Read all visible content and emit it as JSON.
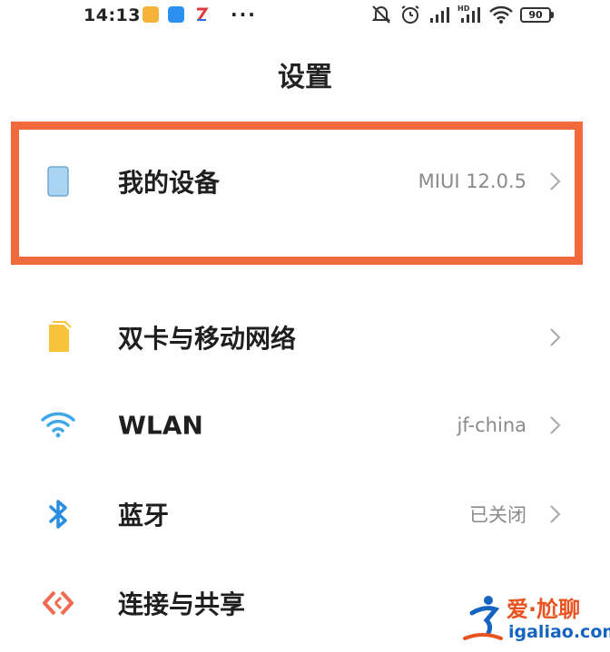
{
  "status_bar": {
    "time": "14:13",
    "more": "···",
    "battery": "90"
  },
  "page": {
    "title": "设置"
  },
  "rows": [
    {
      "label": "我的设备",
      "value": "MIUI 12.0.5",
      "icon": "device-icon"
    },
    {
      "label": "双卡与移动网络",
      "value": "",
      "icon": "sim-card-icon"
    },
    {
      "label": "WLAN",
      "value": "jf-china",
      "icon": "wifi-icon"
    },
    {
      "label": "蓝牙",
      "value": "已关闭",
      "icon": "bluetooth-icon"
    },
    {
      "label": "连接与共享",
      "value": "",
      "icon": "connection-share-icon"
    }
  ],
  "watermark": {
    "name": "爱·尬聊",
    "url": "igaliao.com"
  },
  "colors": {
    "highlight": "#f06a3c",
    "device_icon": "#a9d4f2",
    "sim_icon": "#f7c33b",
    "wifi_icon": "#3fa9e8",
    "bluetooth_icon": "#2a8de0",
    "share_icon": "#ef6a4e"
  }
}
